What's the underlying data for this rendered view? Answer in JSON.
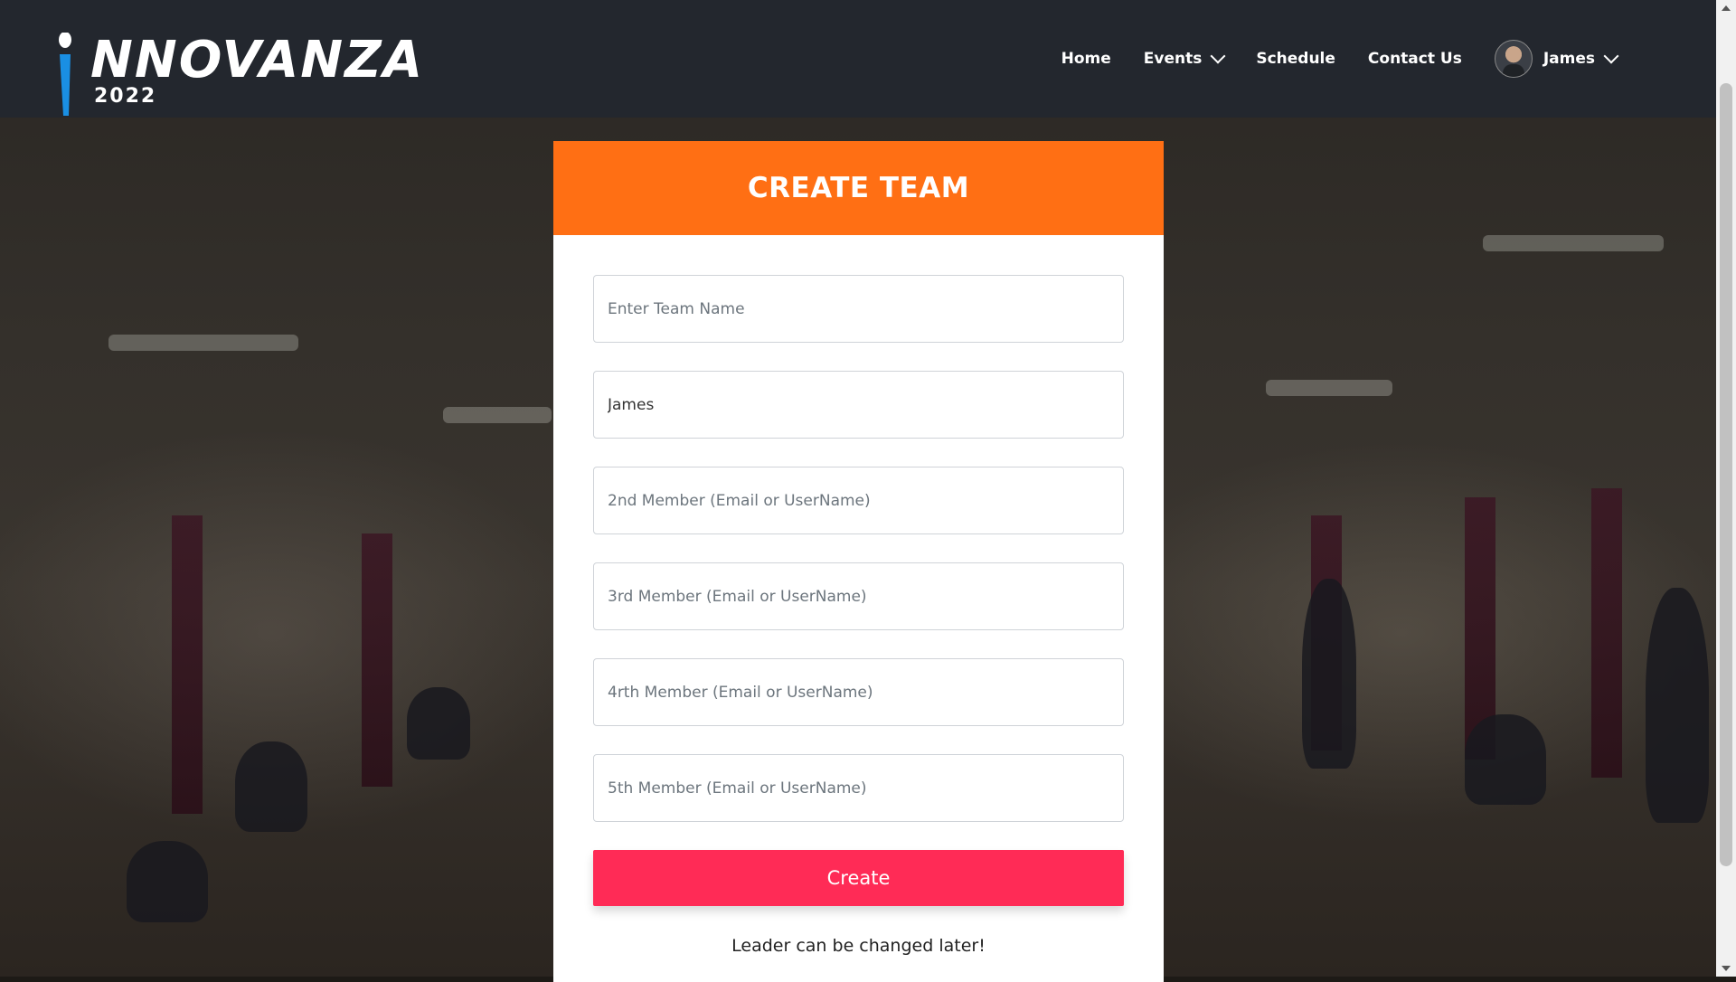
{
  "brand": {
    "logo_text": "NNOVANZA",
    "logo_year": "2022",
    "logo_colors": {
      "white": "#ffffff",
      "blue": "#1a8fe3"
    }
  },
  "nav": {
    "items": [
      {
        "label": "Home"
      },
      {
        "label": "Events",
        "has_dropdown": true
      },
      {
        "label": "Schedule"
      },
      {
        "label": "Contact Us"
      }
    ],
    "user": {
      "name": "James",
      "has_dropdown": true
    }
  },
  "card": {
    "title": "CREATE TEAM",
    "header_color": "#ff6f14",
    "fields": {
      "team_name": {
        "value": "",
        "placeholder": "Enter Team Name"
      },
      "leader": {
        "value": "James",
        "placeholder": ""
      },
      "member2": {
        "value": "",
        "placeholder": "2nd Member (Email or UserName)"
      },
      "member3": {
        "value": "",
        "placeholder": "3rd Member (Email or UserName)"
      },
      "member4": {
        "value": "",
        "placeholder": "4rth Member (Email or UserName)"
      },
      "member5": {
        "value": "",
        "placeholder": "5th Member (Email or UserName)"
      }
    },
    "submit_label": "Create",
    "submit_color": "#ff2b56",
    "note": "Leader can be changed later!"
  },
  "icons": {
    "dropdown": "chevron-down-icon",
    "avatar": "user-avatar",
    "scroll_up": "triangle-up-icon",
    "scroll_down": "triangle-down-icon"
  }
}
